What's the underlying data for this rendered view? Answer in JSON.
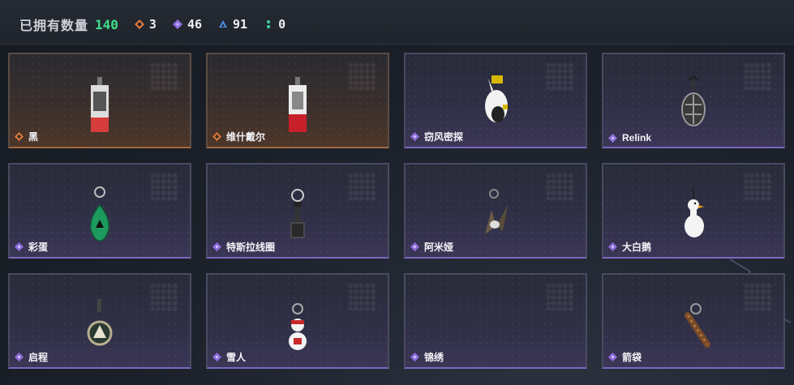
{
  "header": {
    "owned_label": "已拥有数量",
    "owned_count": "140",
    "stats": [
      {
        "icon": "orange-diamond-icon",
        "color": "#e07a3a",
        "value": "3"
      },
      {
        "icon": "purple-diamond-icon",
        "color": "#8f6fe0",
        "value": "46"
      },
      {
        "icon": "blue-triangle-icon",
        "color": "#4a8fe0",
        "value": "91"
      },
      {
        "icon": "green-dots-icon",
        "color": "#3ed49a",
        "value": "0"
      }
    ]
  },
  "cards": [
    {
      "name": "黑",
      "rarity": "orange",
      "art": "tag-charm"
    },
    {
      "name": "维什戴尔",
      "rarity": "orange",
      "art": "tag-charm-red"
    },
    {
      "name": "窃风密探",
      "rarity": "purple",
      "art": "rabbit-charm"
    },
    {
      "name": "Relink",
      "rarity": "purple",
      "art": "turtle-charm"
    },
    {
      "name": "彩蛋",
      "rarity": "purple",
      "art": "green-egg-charm"
    },
    {
      "name": "特斯拉线圈",
      "rarity": "purple",
      "art": "coil-charm"
    },
    {
      "name": "阿米娅",
      "rarity": "purple",
      "art": "ears-charm"
    },
    {
      "name": "大白鹅",
      "rarity": "purple",
      "art": "goose-charm"
    },
    {
      "name": "启程",
      "rarity": "purple",
      "art": "medallion-charm"
    },
    {
      "name": "雪人",
      "rarity": "purple",
      "art": "snowman-charm"
    },
    {
      "name": "锦绣",
      "rarity": "purple",
      "art": "empty"
    },
    {
      "name": "箭袋",
      "rarity": "purple",
      "art": "quiver-charm"
    }
  ]
}
